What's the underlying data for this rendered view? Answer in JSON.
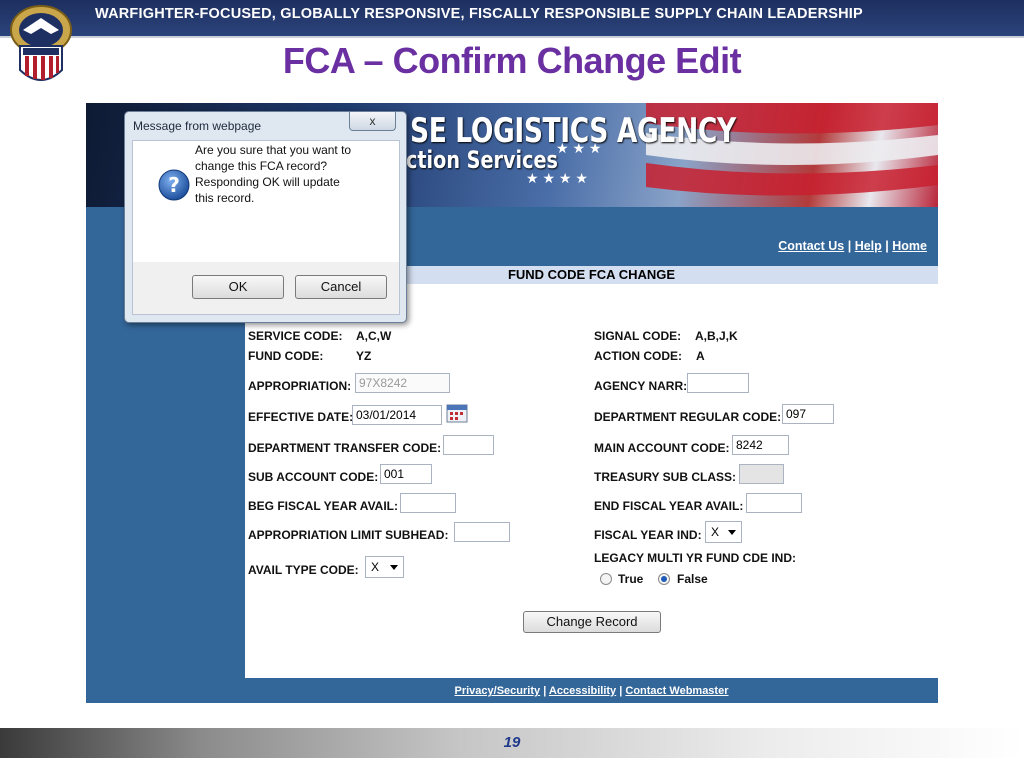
{
  "slide": {
    "motto": "WARFIGHTER-FOCUSED, GLOBALLY RESPONSIVE, FISCALLY RESPONSIBLE SUPPLY CHAIN LEADERSHIP",
    "title": "FCA – Confirm Change Edit",
    "page_number": "19"
  },
  "site": {
    "agency_name": "SE LOGISTICS AGENCY",
    "services_name": "ction Services",
    "links": {
      "contact": "Contact Us",
      "help": "Help",
      "home": "Home",
      "sep": "|"
    },
    "page_header": "FUND CODE FCA CHANGE",
    "footer": {
      "privacy": "Privacy/Security",
      "accessibility": "Accessibility",
      "webmaster": "Contact Webmaster",
      "sep": "|"
    }
  },
  "form": {
    "service_code": {
      "label": "SERVICE CODE:",
      "value": "A,C,W"
    },
    "fund_code": {
      "label": "FUND CODE:",
      "value": "YZ"
    },
    "signal_code": {
      "label": "SIGNAL CODE:",
      "value": "A,B,J,K"
    },
    "action_code": {
      "label": "ACTION CODE:",
      "value": "A"
    },
    "appropriation": {
      "label": "APPROPRIATION:",
      "value": "97X8242"
    },
    "agency_narr": {
      "label": "AGENCY NARR:",
      "value": ""
    },
    "effective_date": {
      "label": "EFFECTIVE DATE:",
      "value": "03/01/2014"
    },
    "dept_regular_code": {
      "label": "DEPARTMENT REGULAR CODE:",
      "value": "097"
    },
    "dept_transfer_code": {
      "label": "DEPARTMENT TRANSFER CODE:",
      "value": ""
    },
    "main_account_code": {
      "label": "MAIN ACCOUNT CODE:",
      "value": "8242"
    },
    "sub_account_code": {
      "label": "SUB ACCOUNT CODE:",
      "value": "001"
    },
    "treasury_sub_class": {
      "label": "TREASURY SUB CLASS:",
      "value": ""
    },
    "beg_fiscal_year": {
      "label": "BEG FISCAL YEAR AVAIL:",
      "value": ""
    },
    "end_fiscal_year": {
      "label": "END FISCAL YEAR AVAIL:",
      "value": ""
    },
    "approp_limit_subhead": {
      "label": "APPROPRIATION LIMIT SUBHEAD:",
      "value": ""
    },
    "fiscal_year_ind": {
      "label": "FISCAL YEAR IND:",
      "value": "X"
    },
    "legacy_multi_yr": {
      "label": "LEGACY MULTI YR FUND CDE IND:",
      "true_label": "True",
      "false_label": "False",
      "selected": "False"
    },
    "avail_type_code": {
      "label": "AVAIL TYPE CODE:",
      "value": "X"
    },
    "submit_label": "Change Record"
  },
  "dialog": {
    "title": "Message from webpage",
    "close": "x",
    "message": "Are you sure that you want to change this FCA record? Responding OK will update this record.",
    "ok": "OK",
    "cancel": "Cancel",
    "icon": "question-icon"
  },
  "colors": {
    "title_purple": "#6a2fa0",
    "site_blue": "#336699",
    "header_navy": "#1d2f5e"
  }
}
